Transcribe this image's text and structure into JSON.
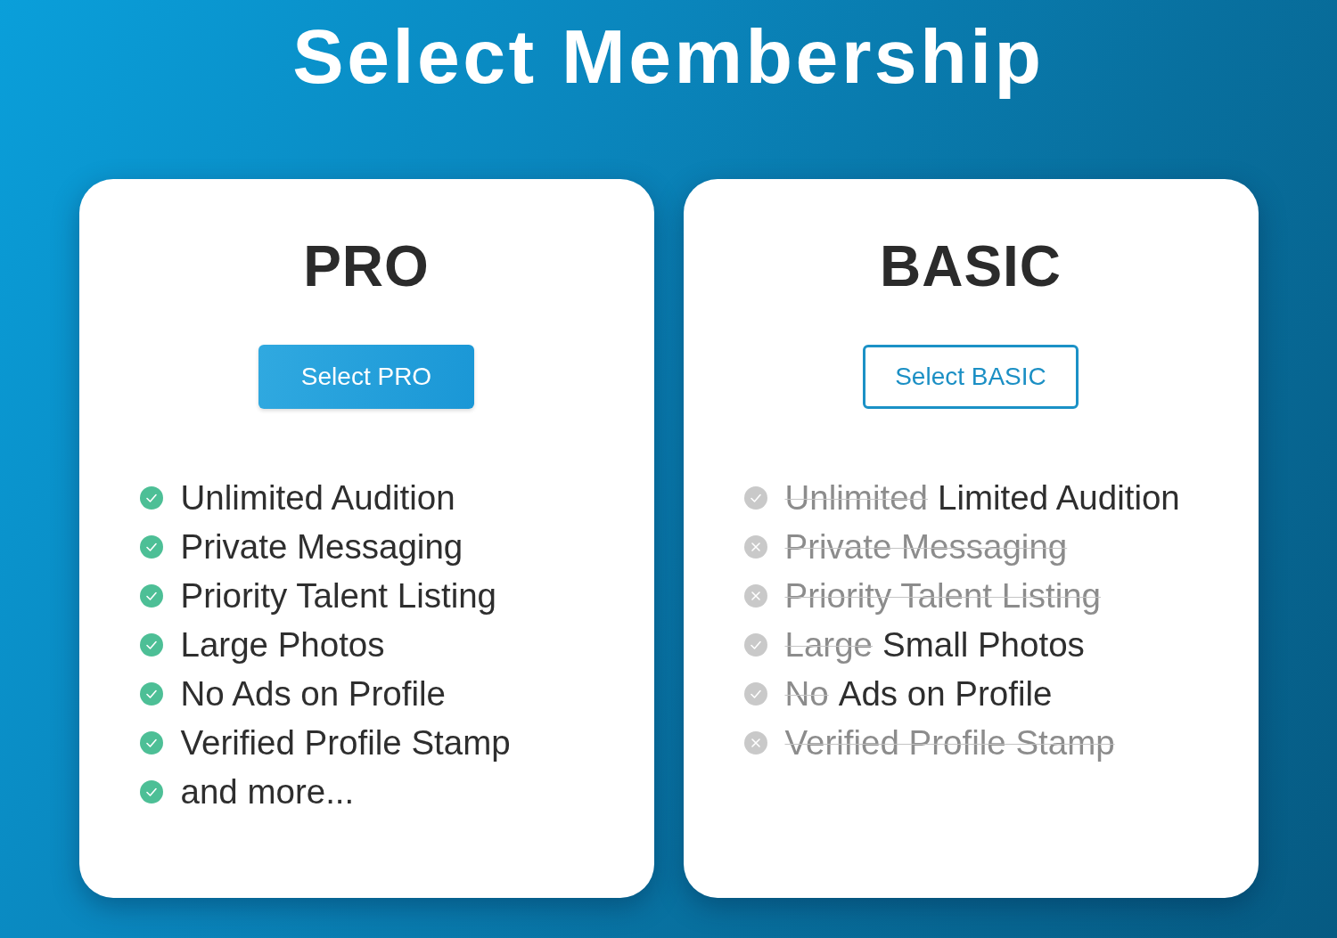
{
  "title": "Select Membership",
  "plans": [
    {
      "name": "PRO",
      "button": {
        "label": "Select PRO",
        "kind": "filled"
      },
      "features": [
        {
          "kind": "check",
          "active": true,
          "parts": [
            {
              "text": "Unlimited Audition",
              "struck": false
            }
          ]
        },
        {
          "kind": "check",
          "active": true,
          "parts": [
            {
              "text": "Private Messaging",
              "struck": false
            }
          ]
        },
        {
          "kind": "check",
          "active": true,
          "parts": [
            {
              "text": "Priority Talent Listing",
              "struck": false
            }
          ]
        },
        {
          "kind": "check",
          "active": true,
          "parts": [
            {
              "text": "Large Photos",
              "struck": false
            }
          ]
        },
        {
          "kind": "check",
          "active": true,
          "parts": [
            {
              "text": "No Ads on Profile",
              "struck": false
            }
          ]
        },
        {
          "kind": "check",
          "active": true,
          "parts": [
            {
              "text": "Verified Profile Stamp",
              "struck": false
            }
          ]
        },
        {
          "kind": "check",
          "active": true,
          "parts": [
            {
              "text": "and more...",
              "struck": false
            }
          ]
        }
      ]
    },
    {
      "name": "BASIC",
      "button": {
        "label": "Select BASIC",
        "kind": "outline"
      },
      "features": [
        {
          "kind": "check",
          "active": false,
          "parts": [
            {
              "text": "Unlimited",
              "struck": true
            },
            {
              "text": "Limited Audition",
              "struck": false
            }
          ]
        },
        {
          "kind": "cross",
          "active": false,
          "parts": [
            {
              "text": "Private Messaging",
              "struck": true
            }
          ]
        },
        {
          "kind": "cross",
          "active": false,
          "parts": [
            {
              "text": "Priority Talent Listing",
              "struck": true
            }
          ]
        },
        {
          "kind": "check",
          "active": false,
          "parts": [
            {
              "text": "Large",
              "struck": true
            },
            {
              "text": "Small Photos",
              "struck": false
            }
          ]
        },
        {
          "kind": "check",
          "active": false,
          "parts": [
            {
              "text": "No",
              "struck": true
            },
            {
              "text": "Ads on Profile",
              "struck": false
            }
          ]
        },
        {
          "kind": "cross",
          "active": false,
          "parts": [
            {
              "text": "Verified Profile Stamp",
              "struck": true
            }
          ]
        }
      ]
    }
  ]
}
